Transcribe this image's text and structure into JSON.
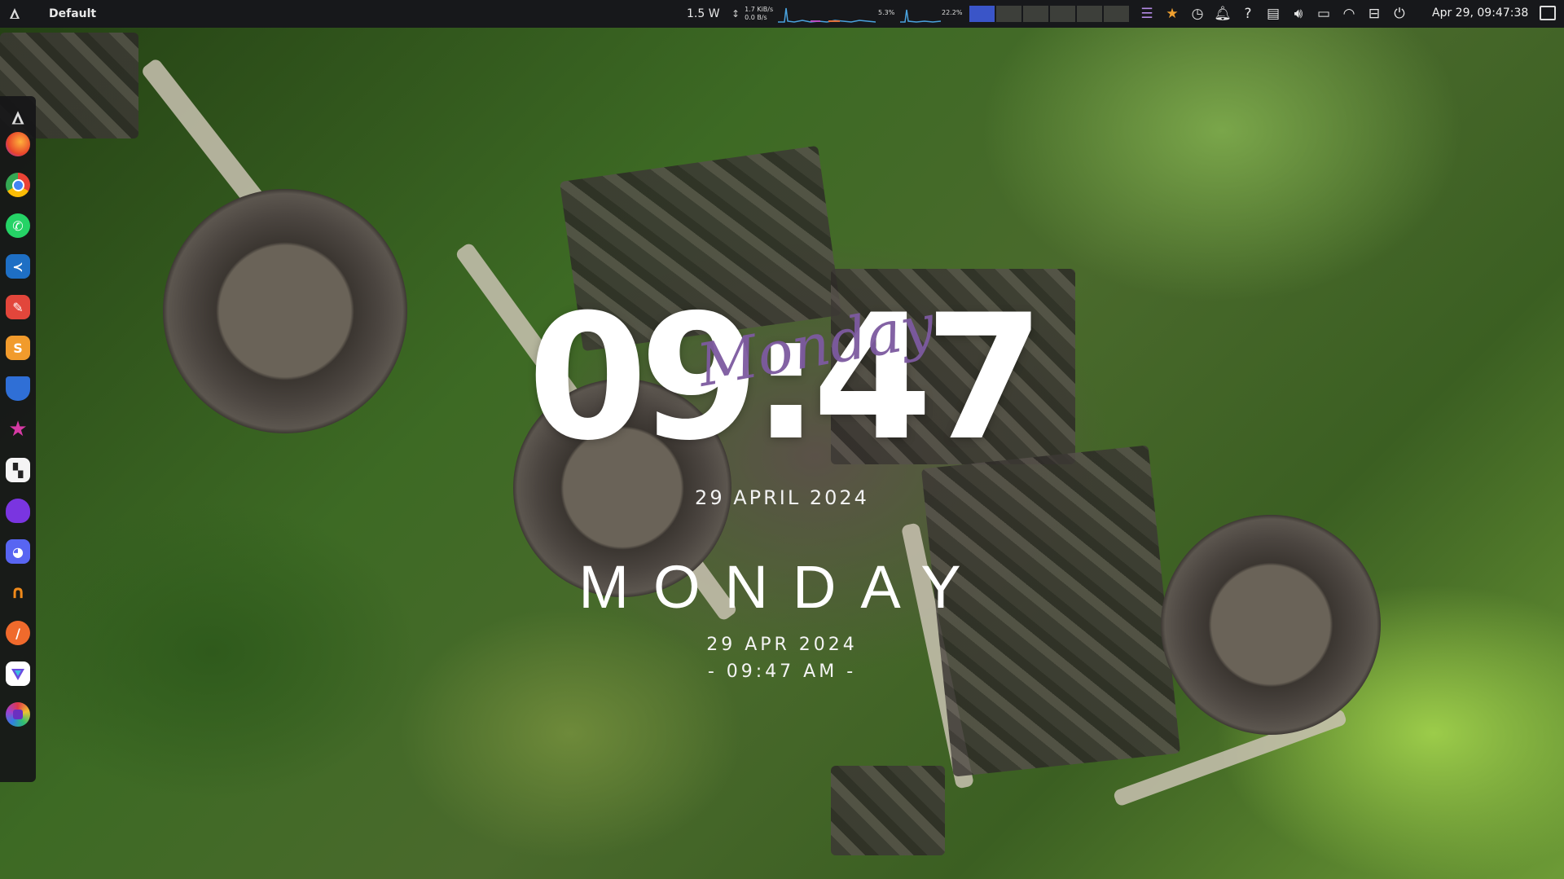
{
  "top_panel": {
    "workspace_label": "Default",
    "power": "1.5 W",
    "net_up": "1.7 KiB/s",
    "net_down": "0.0 B/s",
    "cpu_pct": "5.3%",
    "mem_pct": "22.2%",
    "workspaces": {
      "count": 6,
      "active": 1
    },
    "tray_icons": [
      "menu-icon",
      "star-icon",
      "timer-icon",
      "bell-icon",
      "help-icon",
      "clipboard-icon",
      "volume-icon",
      "battery-icon",
      "wifi-icon",
      "toggle-icon",
      "power-icon"
    ],
    "clock": "Apr 29, 09:47:38"
  },
  "dock": {
    "items": [
      "app-launcher",
      "firefox",
      "chrome",
      "whatsapp",
      "vscode",
      "editor",
      "sublime-text",
      "bitwarden",
      "starred-app",
      "tiling-app",
      "purple-app",
      "discord",
      "headphones-app",
      "color-picker",
      "prism-app",
      "paint-app"
    ]
  },
  "clock_widget": {
    "time": "09:47",
    "script_day": "Monday",
    "date_long": "29 APRIL 2024",
    "weekday": "MONDAY",
    "date_short": "29 APR 2024",
    "time_short": "- 09:47 AM -"
  },
  "colors": {
    "panel_bg": "#17181b",
    "script_purple": "#7d5aa0",
    "workspace_active": "#3a55c8"
  }
}
